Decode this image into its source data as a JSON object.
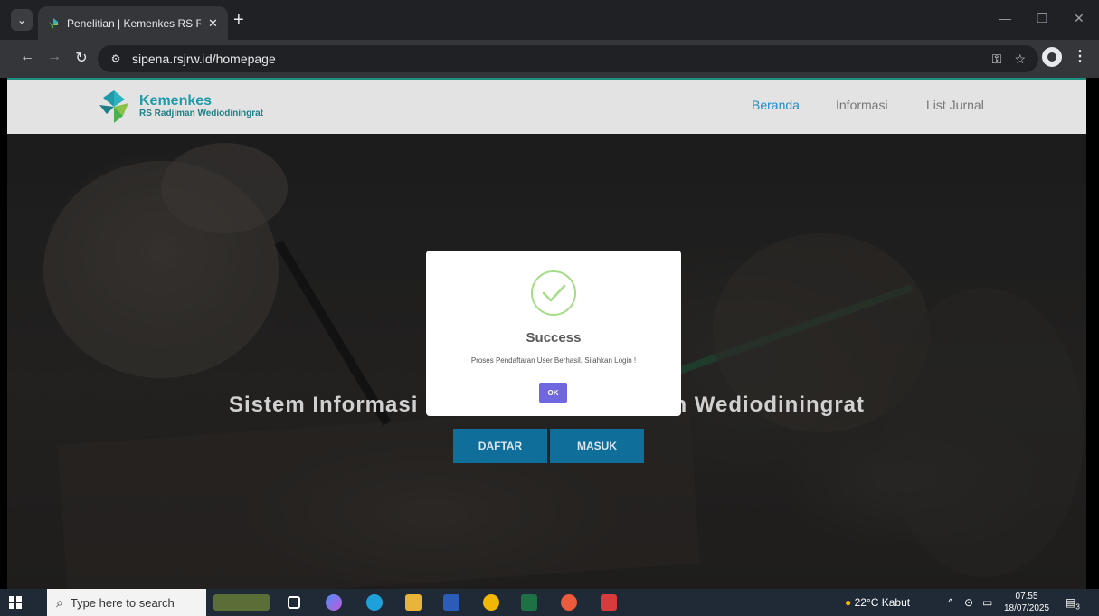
{
  "browser": {
    "tab_title": "Penelitian | Kemenkes RS Radjiman Wediodiningrat",
    "url": "sipena.rsjrw.id/homepage"
  },
  "site": {
    "logo_title": "Kemenkes",
    "logo_subtitle": "RS Radjiman Wediodiningrat",
    "nav": [
      "Beranda",
      "Informasi",
      "List Jurnal"
    ],
    "active_nav": "Beranda",
    "hero_title": "Sistem Informasi Penelitian RS Radjiman Wediodiningrat",
    "buttons": {
      "daftar": "DAFTAR",
      "masuk": "MASUK"
    }
  },
  "modal": {
    "title": "Success",
    "message": "Proses Pendaftaran User Berhasil. Silahkan Login !",
    "ok_label": "OK",
    "accent": "#7066e0",
    "success_color": "#a5dc86"
  },
  "taskbar": {
    "search_placeholder": "Type here to search",
    "weather": "22°C Kabut",
    "time": "07.55",
    "date": "18/07/2025",
    "notification_count": "3"
  }
}
